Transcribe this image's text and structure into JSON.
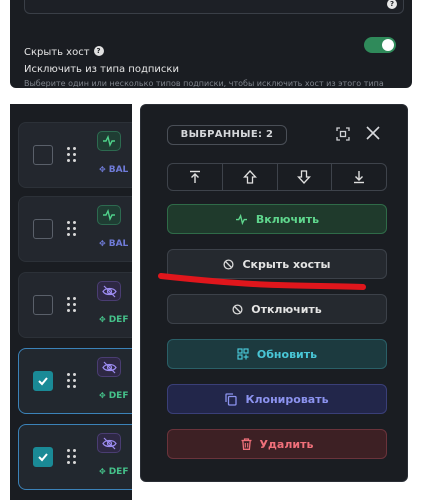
{
  "settings": {
    "hide_host_label": "Скрыть хост",
    "hide_host_enabled": true,
    "exclude_label": "Исключить из типа подписки",
    "exclude_hint": "Выберите один или несколько типов подписки, чтобы исключить хост из этого типа"
  },
  "hosts": [
    {
      "selected": false,
      "status": "active",
      "tag": "BAL"
    },
    {
      "selected": false,
      "status": "active",
      "tag": "BAL"
    },
    {
      "selected": false,
      "status": "hidden",
      "tag": "DEF"
    },
    {
      "selected": true,
      "status": "hidden",
      "tag": "DEF"
    },
    {
      "selected": true,
      "status": "hidden",
      "tag": "DEF"
    }
  ],
  "bulk": {
    "selected_label": "ВЫБРАННЫЕ: 2",
    "actions": {
      "enable": "Включить",
      "hide": "Скрыть хосты",
      "disable": "Отключить",
      "update": "Обновить",
      "clone": "Клонировать",
      "delete": "Удалить"
    }
  },
  "colors": {
    "annotation": "#e0161c",
    "toggle_on": "#2f8a5a",
    "checkbox_on": "#1a8a96"
  },
  "icons": [
    "help-icon",
    "activity-icon",
    "eye-off-icon",
    "drag-handle-icon",
    "focus-icon",
    "close-icon",
    "move-top-icon",
    "move-up-icon",
    "move-down-icon",
    "move-bottom-icon",
    "ban-icon",
    "grid-plus-icon",
    "copy-icon",
    "trash-icon"
  ]
}
